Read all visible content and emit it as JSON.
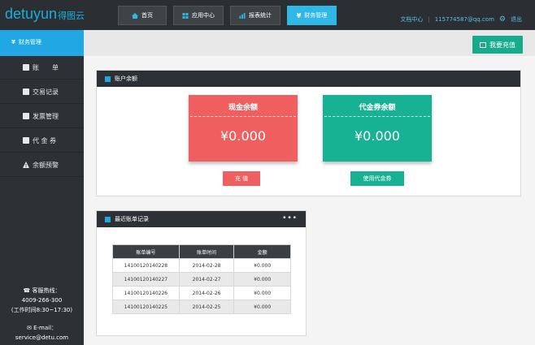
{
  "brand": {
    "logo_latin": "detuyun",
    "logo_cn": "得图云",
    "accent": "#21a7e3"
  },
  "nav": {
    "items": [
      {
        "label": "首页",
        "icon": "home-icon",
        "active": false
      },
      {
        "label": "应用中心",
        "icon": "apps-icon",
        "active": false
      },
      {
        "label": "报表统计",
        "icon": "chart-icon",
        "active": false
      },
      {
        "label": "财务管理",
        "icon": "yen-icon",
        "active": true
      }
    ],
    "docs": "文档中心",
    "sep": "|",
    "email": "115774587@qq.com",
    "logout": "退出"
  },
  "sidebar": {
    "active": {
      "icon": "yen-icon",
      "label": "财务管理"
    },
    "items": [
      {
        "label": "账　　单",
        "icon": "bill-icon"
      },
      {
        "label": "交易记录",
        "icon": "transaction-icon"
      },
      {
        "label": "发票管理",
        "icon": "invoice-icon"
      },
      {
        "label": "代 金 券",
        "icon": "voucher-icon"
      },
      {
        "label": "余额预警",
        "icon": "warning-icon"
      }
    ],
    "hotline_label": "客服热线：",
    "hotline_number": "4009-266-300",
    "hours": "(工作时间8:30~17:30)",
    "email_label": "E-mail：",
    "email": "service@detu.com"
  },
  "toolbar": {
    "recharge_label": "我要充值"
  },
  "balance_panel": {
    "title": "账户余额",
    "cash": {
      "title": "现金余额",
      "value": "¥0.000",
      "color": "#f05f5f",
      "button": "充 值"
    },
    "voucher": {
      "title": "代金券余额",
      "value": "¥0.000",
      "color": "#17b294",
      "button": "使用代金券"
    }
  },
  "bills_panel": {
    "title": "最近账单记录",
    "more": "•••",
    "columns": [
      "账单编号",
      "账单时间",
      "金额"
    ],
    "rows": [
      [
        "14100120140228",
        "2014-02-28",
        "¥0.000"
      ],
      [
        "14100120140227",
        "2014-02-27",
        "¥0.000"
      ],
      [
        "14100120140226",
        "2014-02-26",
        "¥0.000"
      ],
      [
        "14100120140225",
        "2014-02-25",
        "¥0.000"
      ]
    ]
  }
}
